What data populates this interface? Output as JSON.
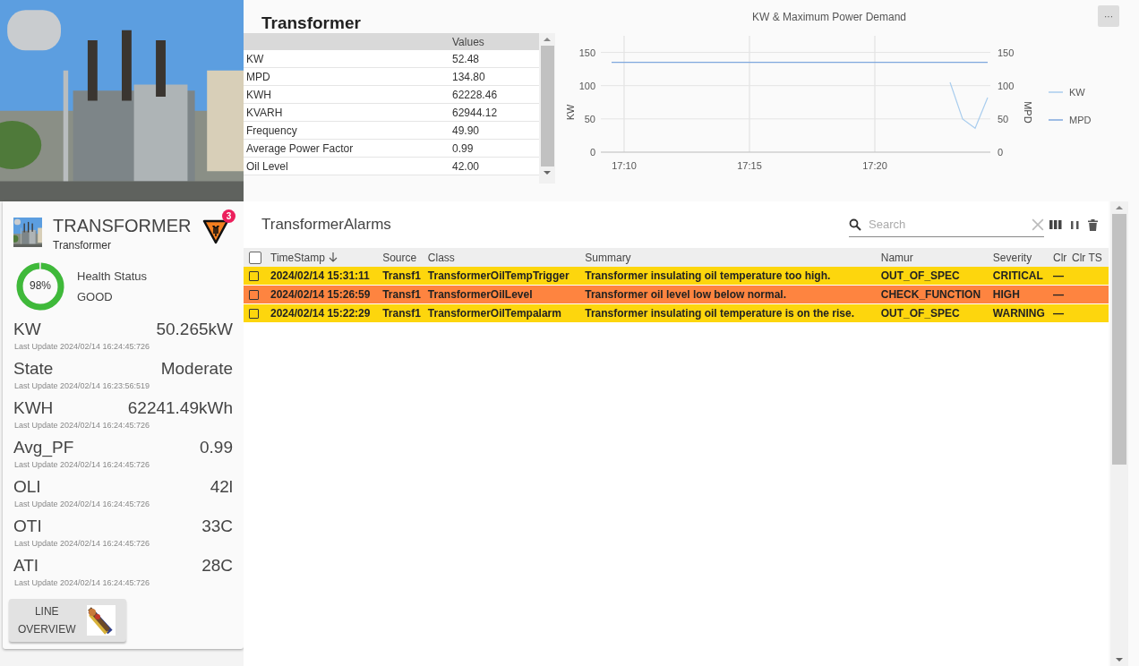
{
  "asset": {
    "name": "TRANSFORMER",
    "type": "Transformer",
    "alert_count": "3"
  },
  "health": {
    "percent": "98%",
    "level": 0.98,
    "label": "Health Status",
    "status": "GOOD"
  },
  "metrics": [
    {
      "label": "KW",
      "value": "50.265kW",
      "updated": "Last Update 2024/02/14 16:24:45:726"
    },
    {
      "label": "State",
      "value": "Moderate",
      "updated": "Last Update 2024/02/14 16:23:56:519"
    },
    {
      "label": "KWH",
      "value": "62241.49kWh",
      "updated": "Last Update 2024/02/14 16:24:45:726"
    },
    {
      "label": "Avg_PF",
      "value": "0.99",
      "updated": "Last Update 2024/02/14 16:24:45:726"
    },
    {
      "label": "OLI",
      "value": "42l",
      "updated": "Last Update 2024/02/14 16:24:45:726"
    },
    {
      "label": "OTI",
      "value": "33C",
      "updated": "Last Update 2024/02/14 16:24:45:726"
    },
    {
      "label": "ATI",
      "value": "28C",
      "updated": "Last Update 2024/02/14 16:24:45:726"
    }
  ],
  "nav_button": {
    "lines": [
      "LINE",
      "OVERVIEW"
    ]
  },
  "properties": {
    "title": "Transformer",
    "value_header": "Values",
    "rows": [
      {
        "name": "KW",
        "value": "52.48"
      },
      {
        "name": "MPD",
        "value": "134.80"
      },
      {
        "name": "KWH",
        "value": "62228.46"
      },
      {
        "name": "KVARH",
        "value": "62944.12"
      },
      {
        "name": "Frequency",
        "value": "49.90"
      },
      {
        "name": "Average Power Factor",
        "value": "0.99"
      },
      {
        "name": "Oil Level",
        "value": "42.00"
      }
    ]
  },
  "chart_panel": {
    "menu_button": "···",
    "chart_data": {
      "type": "line",
      "title": "KW & Maximum Power Demand",
      "ylabel": "KW",
      "y2label": "MPD",
      "categories": [
        null,
        "17:10",
        null,
        null,
        null,
        null,
        null,
        null,
        null,
        null,
        null,
        "17:15",
        null,
        null,
        null,
        null,
        null,
        null,
        null,
        null,
        null,
        "17:20",
        null,
        null,
        null,
        null,
        null,
        null,
        null,
        null,
        null
      ],
      "ylim": [
        0,
        175
      ],
      "y2lim": [
        0,
        175
      ],
      "grid": true,
      "legend": true,
      "yticks": [
        0,
        50,
        100,
        150
      ],
      "y2ticks": [
        0,
        50,
        100,
        150
      ],
      "series": [
        {
          "name": "KW",
          "color": "#a9cdee",
          "values": [
            null,
            null,
            null,
            null,
            null,
            null,
            null,
            null,
            null,
            null,
            null,
            null,
            null,
            null,
            null,
            null,
            null,
            null,
            null,
            null,
            null,
            null,
            null,
            null,
            null,
            null,
            null,
            105,
            50,
            36,
            82
          ]
        },
        {
          "name": "MPD",
          "color": "#7fa7dd",
          "values": [
            135,
            135,
            135,
            135,
            135,
            135,
            135,
            135,
            135,
            135,
            135,
            135,
            135,
            135,
            135,
            135,
            135,
            135,
            135,
            135,
            135,
            135,
            135,
            135,
            135,
            135,
            135,
            135,
            135,
            135,
            135
          ]
        }
      ]
    }
  },
  "alarms": {
    "title": "TransformerAlarms",
    "search": {
      "placeholder": "Search"
    },
    "columns": [
      "TimeStamp",
      "Source",
      "Class",
      "Summary",
      "Namur",
      "Severity",
      "Clr",
      "Clr TS"
    ],
    "header_checked": false,
    "rows": [
      {
        "checked": false,
        "color": "#fdd60d",
        "cells": [
          "2024/02/14 15:31:11",
          "Transf1",
          "TransformerOilTempTrigger",
          "Transformer insulating oil temperature too high.",
          "OUT_OF_SPEC",
          "CRITICAL",
          "—"
        ]
      },
      {
        "checked": false,
        "color": "#fe8440",
        "cells": [
          "2024/02/14 15:26:59",
          "Transf1",
          "TransformerOilLevel",
          "Transformer oil level low below normal.",
          "CHECK_FUNCTION",
          "HIGH",
          "—"
        ]
      },
      {
        "checked": false,
        "color": "#fdd60d",
        "cells": [
          "2024/02/14 15:22:29",
          "Transf1",
          "TransformerOilTempalarm",
          "Transformer insulating oil temperature is on the rise.",
          "OUT_OF_SPEC",
          "WARNING",
          "—"
        ]
      }
    ]
  }
}
